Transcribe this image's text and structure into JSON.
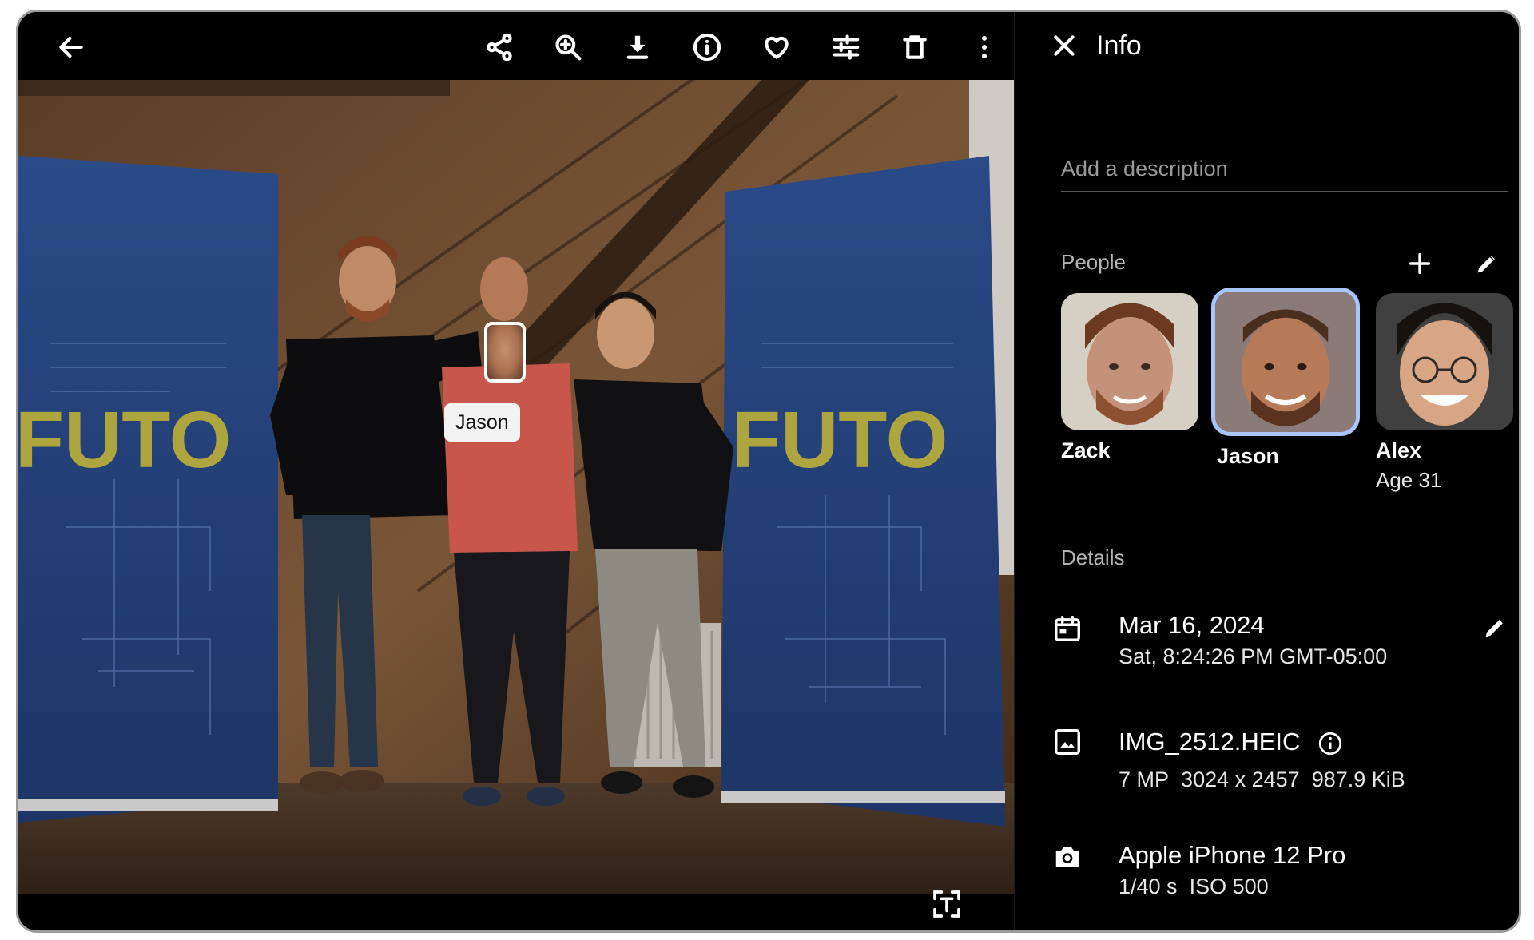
{
  "toolbar": {
    "buttons": [
      "back-icon",
      "share-icon",
      "zoom-in-icon",
      "download-icon",
      "info-icon",
      "favorite-icon",
      "edit-adjust-icon",
      "delete-icon",
      "more-vert-icon"
    ]
  },
  "photo": {
    "banner_text_left": "FUTO",
    "banner_text_right": "FUTO",
    "face_tag_label": "Jason"
  },
  "panel": {
    "title": "Info",
    "description_placeholder": "Add a description",
    "people_heading": "People",
    "people": [
      {
        "name": "Zack",
        "sub": ""
      },
      {
        "name": "Jason",
        "sub": ""
      },
      {
        "name": "Alex",
        "sub": "Age 31"
      }
    ],
    "details_heading": "Details",
    "date": {
      "primary": "Mar 16, 2024",
      "secondary": "Sat, 8:24:26 PM GMT-05:00"
    },
    "file": {
      "name": "IMG_2512.HEIC",
      "megapixels": "7 MP",
      "dimensions": "3024 x 2457",
      "size": "987.9 KiB"
    },
    "camera": {
      "model": "Apple iPhone 12 Pro",
      "exposure": "1/40 s",
      "iso": "ISO 500"
    }
  },
  "colors": {
    "background": "#000000",
    "selection_ring": "#a9c5ff",
    "banner_blue": "#233f78",
    "banner_text": "#c8b735"
  }
}
